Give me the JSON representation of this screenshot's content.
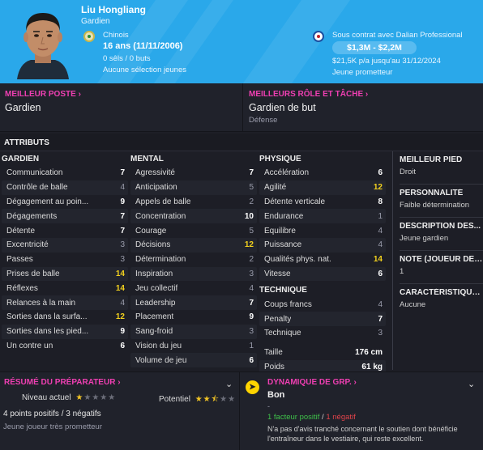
{
  "player": {
    "name": "Liu Hongliang",
    "position": "Gardien",
    "nationality": "Chinois",
    "age": "16 ans (11/11/2006)",
    "caps": "0 sêls / 0 buts",
    "youth_caps": "Aucune sélection jeunes"
  },
  "contract": {
    "club_line": "Sous contrat avec Dalian Professional",
    "value": "$1,3M - $2,2M",
    "wage": "$21,5K p/a jusqu'au 31/12/2024",
    "status": "Jeune prometteur"
  },
  "best_position": {
    "label": "MEILLEUR POSTE",
    "value": "Gardien"
  },
  "best_role": {
    "label": "MEILLEURS RÔLE ET TÂCHE",
    "value": "Gardien de but",
    "sub": "Défense"
  },
  "attributes_title": "ATTRIBUTS",
  "goalkeeper": {
    "title": "GARDIEN",
    "rows": [
      {
        "k": "Communication",
        "v": "7"
      },
      {
        "k": "Contrôle de balle",
        "v": "4"
      },
      {
        "k": "Dégagement au poin...",
        "v": "9"
      },
      {
        "k": "Dégagements",
        "v": "7"
      },
      {
        "k": "Détente",
        "v": "7"
      },
      {
        "k": "Excentricité",
        "v": "3"
      },
      {
        "k": "Passes",
        "v": "3"
      },
      {
        "k": "Prises de balle",
        "v": "14"
      },
      {
        "k": "Réflexes",
        "v": "14"
      },
      {
        "k": "Relances à la main",
        "v": "4"
      },
      {
        "k": "Sorties dans la surfa...",
        "v": "12"
      },
      {
        "k": "Sorties dans les pied...",
        "v": "9"
      },
      {
        "k": "Un contre un",
        "v": "6"
      }
    ]
  },
  "mental": {
    "title": "MENTAL",
    "rows": [
      {
        "k": "Agressivité",
        "v": "7"
      },
      {
        "k": "Anticipation",
        "v": "5"
      },
      {
        "k": "Appels de balle",
        "v": "2"
      },
      {
        "k": "Concentration",
        "v": "10"
      },
      {
        "k": "Courage",
        "v": "5"
      },
      {
        "k": "Décisions",
        "v": "12"
      },
      {
        "k": "Détermination",
        "v": "2"
      },
      {
        "k": "Inspiration",
        "v": "3"
      },
      {
        "k": "Jeu collectif",
        "v": "4"
      },
      {
        "k": "Leadership",
        "v": "7"
      },
      {
        "k": "Placement",
        "v": "9"
      },
      {
        "k": "Sang-froid",
        "v": "3"
      },
      {
        "k": "Vision du jeu",
        "v": "1"
      },
      {
        "k": "Volume de jeu",
        "v": "6"
      }
    ]
  },
  "physical": {
    "title": "PHYSIQUE",
    "rows": [
      {
        "k": "Accélération",
        "v": "6"
      },
      {
        "k": "Agilité",
        "v": "12"
      },
      {
        "k": "Détente verticale",
        "v": "8"
      },
      {
        "k": "Endurance",
        "v": "1"
      },
      {
        "k": "Équilibre",
        "v": "4"
      },
      {
        "k": "Puissance",
        "v": "4"
      },
      {
        "k": "Qualités phys. nat.",
        "v": "14"
      },
      {
        "k": "Vitesse",
        "v": "6"
      }
    ]
  },
  "technique": {
    "title": "TECHNIQUE",
    "rows": [
      {
        "k": "Coups francs",
        "v": "4"
      },
      {
        "k": "Penalty",
        "v": "7"
      },
      {
        "k": "Technique",
        "v": "3"
      }
    ]
  },
  "measures": {
    "height_label": "Taille",
    "height": "176 cm",
    "weight_label": "Poids",
    "weight": "61 kg"
  },
  "side": {
    "foot_label": "MEILLEUR PIED",
    "foot": "Droit",
    "personality_label": "PERSONNALITÉ",
    "personality": "Faible détermination",
    "description_label": "DESCRIPTION DES...",
    "description": "Jeune gardien",
    "note_label": "NOTE (JOUEUR DE C...",
    "note": "1",
    "traits_label": "CARACTÉRISTIQUE...",
    "traits": "Aucune"
  },
  "coach": {
    "title": "RÉSUMÉ DU PRÉPARATEUR",
    "current_label": "Niveau actuel",
    "current_stars": 1,
    "potential_label": "Potentiel",
    "potential_stars": 2.5,
    "points": "4 points positifs / 3 négatifs",
    "summary": "Jeune joueur très prometteur"
  },
  "dynamics": {
    "title": "DYNAMIQUE DE GRP.",
    "value": "Bon",
    "dash": "-",
    "positive": "1 facteur positif",
    "slash": " / ",
    "negative": "1 négatif",
    "text": "N'a pas d'avis tranché concernant le soutien dont bénéficie l'entraîneur dans le vestiaire, qui reste excellent."
  },
  "colors": {
    "header": "#2aa8ea",
    "accent": "#ef3fb2",
    "highlight": "#f2d11e",
    "positive": "#3fc24a",
    "negative": "#e0434a"
  }
}
